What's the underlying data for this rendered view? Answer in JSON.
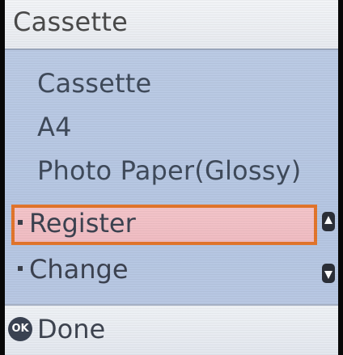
{
  "title": "Cassette",
  "info": {
    "source": "Cassette",
    "size": "A4",
    "type": "Photo Paper(Glossy)"
  },
  "menu": {
    "items": [
      {
        "label": "Register",
        "selected": true
      },
      {
        "label": "Change",
        "selected": false
      }
    ]
  },
  "footer": {
    "ok_icon_text": "OK",
    "done_label": "Done"
  },
  "icons": {
    "scroll_up": "triangle-up-icon",
    "scroll_down": "triangle-down-icon",
    "ok": "ok-button-icon"
  },
  "colors": {
    "selection_border": "#e2752c",
    "selection_fill": "#f3c4c9",
    "background": "#b9c8e3"
  }
}
